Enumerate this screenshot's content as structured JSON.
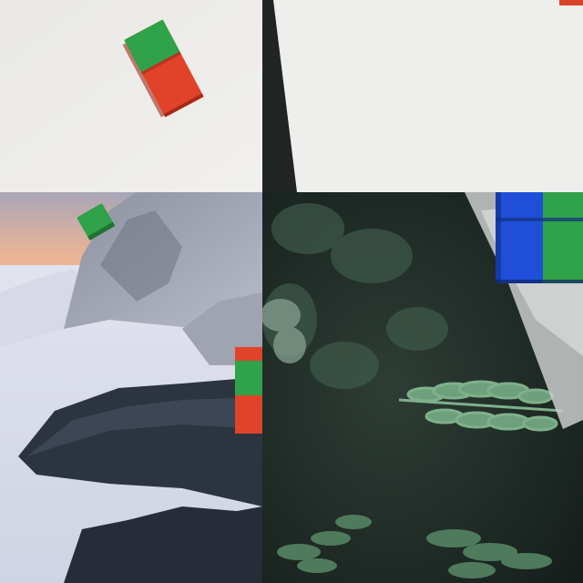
{
  "tiles": [
    {
      "id": "top-left",
      "subject": "lego-brick-on-white"
    },
    {
      "id": "top-right",
      "subject": "white-surface"
    },
    {
      "id": "bottom-left",
      "subject": "snowy-mountain-landscape"
    },
    {
      "id": "bottom-right",
      "subject": "forest-ferns"
    }
  ],
  "colors": {
    "brick_red": "#e0432a",
    "brick_green": "#2fa24a",
    "brick_blue": "#1f4fd8",
    "paper_white": "#ecebe8",
    "sky_peach": "#f3b08c",
    "snow": "#dfe3ee",
    "forest_dark": "#1e2a25"
  }
}
